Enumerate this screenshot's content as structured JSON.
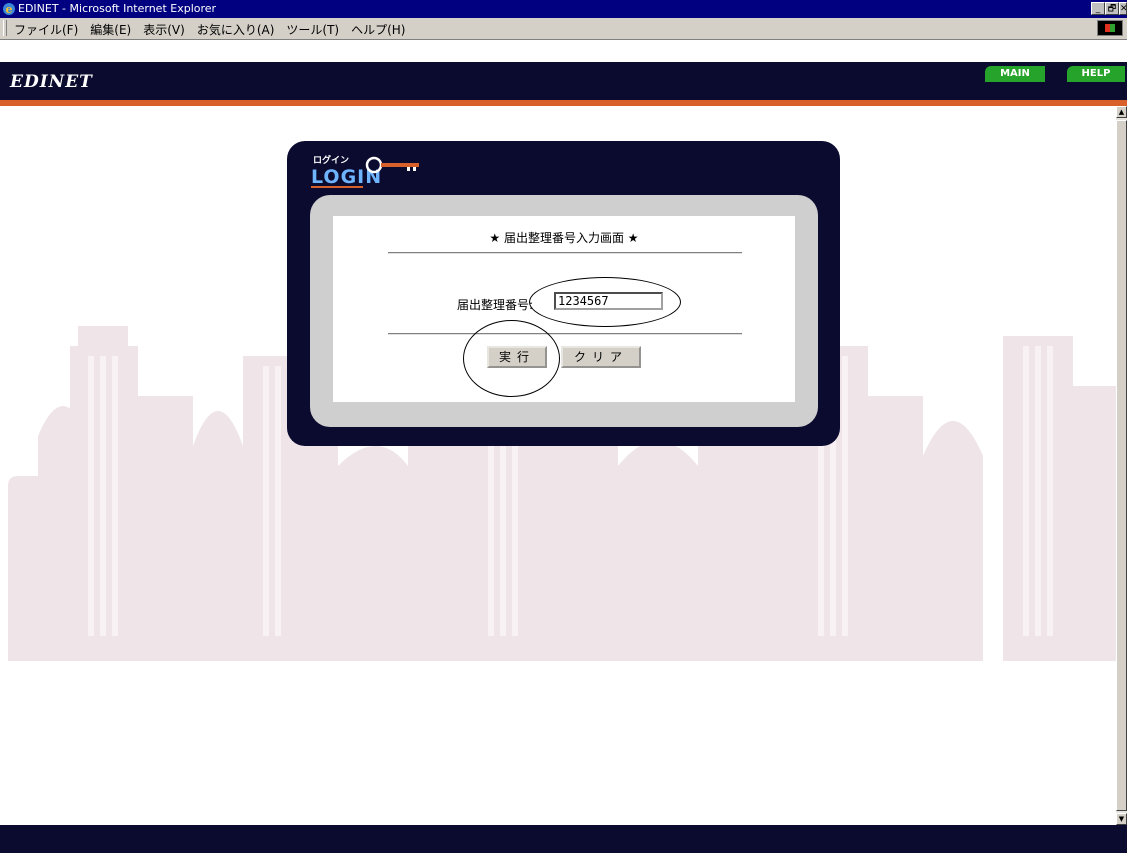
{
  "window": {
    "title": "EDINET - Microsoft Internet Explorer",
    "minimize_glyph": "_",
    "restore_glyph": "🗗",
    "close_glyph": "✕"
  },
  "menu": {
    "items": [
      "ファイル(F)",
      "編集(E)",
      "表示(V)",
      "お気に入り(A)",
      "ツール(T)",
      "ヘルプ(H)"
    ]
  },
  "header": {
    "logo": "EDINET",
    "main_label": "MAIN",
    "help_label": "HELP"
  },
  "login": {
    "logo_kana": "ログイン",
    "logo_text": "LOGIN",
    "form_title": "★ 届出整理番号入力画面 ★",
    "field_label": "届出整理番号:",
    "field_value": "1234567",
    "execute_label": "実行",
    "clear_label": "クリア"
  },
  "colors": {
    "titlebar": "#000080",
    "header_bg": "#0b0b30",
    "accent_orange": "#d8602a",
    "nav_green": "#26a32a",
    "panel_gray": "#cfcfcf",
    "skyline": "#efe4e8"
  },
  "icons": {
    "app": "ie-icon",
    "login_key": "key-icon",
    "windows_logo": "windows-logo-icon"
  }
}
